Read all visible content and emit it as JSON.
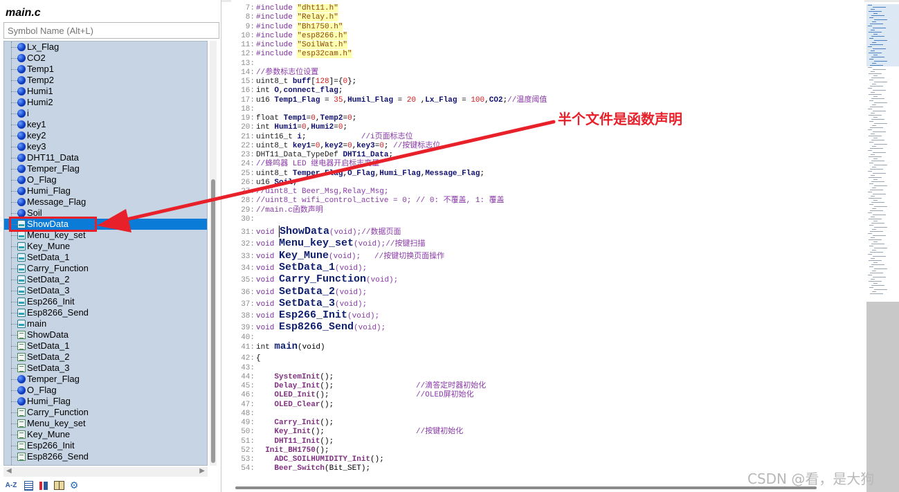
{
  "file_title": "main.c",
  "symbol_search": {
    "placeholder": "Symbol Name (Alt+L)"
  },
  "symbols": [
    {
      "label": "Lx_Flag",
      "icon": "var"
    },
    {
      "label": "CO2",
      "icon": "var"
    },
    {
      "label": "Temp1",
      "icon": "var"
    },
    {
      "label": "Temp2",
      "icon": "var"
    },
    {
      "label": "Humi1",
      "icon": "var"
    },
    {
      "label": "Humi2",
      "icon": "var"
    },
    {
      "label": "i",
      "icon": "var"
    },
    {
      "label": "key1",
      "icon": "var"
    },
    {
      "label": "key2",
      "icon": "var"
    },
    {
      "label": "key3",
      "icon": "var"
    },
    {
      "label": "DHT11_Data",
      "icon": "var"
    },
    {
      "label": "Temper_Flag",
      "icon": "var"
    },
    {
      "label": "O_Flag",
      "icon": "var"
    },
    {
      "label": "Humi_Flag",
      "icon": "var"
    },
    {
      "label": "Message_Flag",
      "icon": "var"
    },
    {
      "label": "Soil",
      "icon": "var"
    },
    {
      "label": "ShowData",
      "icon": "func",
      "selected": true
    },
    {
      "label": "Menu_key_set",
      "icon": "func"
    },
    {
      "label": "Key_Mune",
      "icon": "func"
    },
    {
      "label": "SetData_1",
      "icon": "func"
    },
    {
      "label": "Carry_Function",
      "icon": "func"
    },
    {
      "label": "SetData_2",
      "icon": "func"
    },
    {
      "label": "SetData_3",
      "icon": "func"
    },
    {
      "label": "Esp266_Init",
      "icon": "func"
    },
    {
      "label": "Esp8266_Send",
      "icon": "func"
    },
    {
      "label": "main",
      "icon": "func"
    },
    {
      "label": "ShowData",
      "icon": "ref"
    },
    {
      "label": "SetData_1",
      "icon": "ref"
    },
    {
      "label": "SetData_2",
      "icon": "ref"
    },
    {
      "label": "SetData_3",
      "icon": "ref"
    },
    {
      "label": "Temper_Flag",
      "icon": "var"
    },
    {
      "label": "O_Flag",
      "icon": "var"
    },
    {
      "label": "Humi_Flag",
      "icon": "var"
    },
    {
      "label": "Carry_Function",
      "icon": "ref"
    },
    {
      "label": "Menu_key_set",
      "icon": "ref"
    },
    {
      "label": "Key_Mune",
      "icon": "ref"
    },
    {
      "label": "Esp266_Init",
      "icon": "ref"
    },
    {
      "label": "Esp8266_Send",
      "icon": "ref"
    }
  ],
  "code_lines": [
    {
      "n": "7:",
      "t": "#include \"dht11.h\""
    },
    {
      "n": "8:",
      "t": "#include \"Relay.h\""
    },
    {
      "n": "9:",
      "t": "#include \"Bh1750.h\""
    },
    {
      "n": "10:",
      "t": "#include \"esp8266.h\""
    },
    {
      "n": "11:",
      "t": "#include \"SoilWat.h\""
    },
    {
      "n": "12:",
      "t": "#include \"esp32cam.h\""
    },
    {
      "n": "13:",
      "t": ""
    },
    {
      "n": "14:",
      "t": "//参数标志位设置"
    },
    {
      "n": "15:",
      "t": "uint8_t buff[128]={0};"
    },
    {
      "n": "16:",
      "t": "int O,connect_flag;"
    },
    {
      "n": "17:",
      "t": "u16 Temp1_Flag = 35,Humil_Flag = 20 ,Lx_Flag = 100,CO2;//温度阈值"
    },
    {
      "n": "18:",
      "t": ""
    },
    {
      "n": "19:",
      "t": "float Temp1=0,Temp2=0;"
    },
    {
      "n": "20:",
      "t": "int Humi1=0,Humi2=0;"
    },
    {
      "n": "21:",
      "t": "uint16_t i;            //i页面标志位"
    },
    {
      "n": "22:",
      "t": "uint8_t key1=0,key2=0,key3=0; //按键标志位"
    },
    {
      "n": "23:",
      "t": "DHT11_Data_TypeDef DHT11_Data;"
    },
    {
      "n": "24:",
      "t": "//蜂鸣器 LED 继电器开启标志变量"
    },
    {
      "n": "25:",
      "t": "uint8_t Temper_Flag,O_Flag,Humi_Flag,Message_Flag;"
    },
    {
      "n": "26:",
      "t": "u16 Soil;"
    },
    {
      "n": "27:",
      "t": "//uint8_t Beer_Msg,Relay_Msg;"
    },
    {
      "n": "28:",
      "t": "//uint8_t wifi_control_active = 0; // 0: 不覆盖, 1: 覆盖"
    },
    {
      "n": "29:",
      "t": "//main.c函数声明"
    },
    {
      "n": "30:",
      "t": ""
    }
  ],
  "decl_lines": [
    {
      "n": "31:",
      "name": "ShowData",
      "args": "(void);",
      "cmt": "//数据页面"
    },
    {
      "n": "32:",
      "name": "Menu_key_set",
      "args": "(void);",
      "cmt": "//按键扫描"
    },
    {
      "n": "33:",
      "name": "Key_Mune",
      "args": "(void);   ",
      "cmt": "//按键切换页面操作"
    },
    {
      "n": "34:",
      "name": "SetData_1",
      "args": "(void);",
      "cmt": ""
    },
    {
      "n": "35:",
      "name": "Carry_Function",
      "args": "(void);",
      "cmt": ""
    },
    {
      "n": "36:",
      "name": "SetData_2",
      "args": "(void);",
      "cmt": ""
    },
    {
      "n": "37:",
      "name": "SetData_3",
      "args": "(void);",
      "cmt": ""
    },
    {
      "n": "38:",
      "name": "Esp266_Init",
      "args": "(void);",
      "cmt": ""
    },
    {
      "n": "39:",
      "name": "Esp8266_Send",
      "args": "(void);",
      "cmt": ""
    }
  ],
  "main_lines": [
    {
      "n": "40:",
      "t": ""
    },
    {
      "n": "41:",
      "t": "int main(void)"
    },
    {
      "n": "42:",
      "t": "{"
    },
    {
      "n": "43:",
      "t": ""
    },
    {
      "n": "44:",
      "t": "    SystemInit();"
    },
    {
      "n": "45:",
      "t": "    Delay_Init();                  //滴答定时器初始化"
    },
    {
      "n": "46:",
      "t": "    OLED_Init();                   //OLED屏初始化"
    },
    {
      "n": "47:",
      "t": "    OLED_Clear();"
    },
    {
      "n": "48:",
      "t": ""
    },
    {
      "n": "49:",
      "t": "    Carry_Init();"
    },
    {
      "n": "50:",
      "t": "    Key_Init();                    //按键初始化"
    },
    {
      "n": "51:",
      "t": "    DHT11_Init();"
    },
    {
      "n": "52:",
      "t": "  Init_BH1750();"
    },
    {
      "n": "53:",
      "t": "    ADC_SOILHUMIDITY_Init();"
    },
    {
      "n": "54:",
      "t": "    Beer_Switch(Bit_SET);"
    }
  ],
  "annotation": "半个文件是函数声明",
  "watermark": "CSDN @看，是大狗",
  "toolbar": {
    "sort_label": "A-Z"
  },
  "colors": {
    "accent_red": "#e8202a",
    "selection_blue": "#0a7bd6",
    "panel_bg": "#c6d4e3"
  }
}
